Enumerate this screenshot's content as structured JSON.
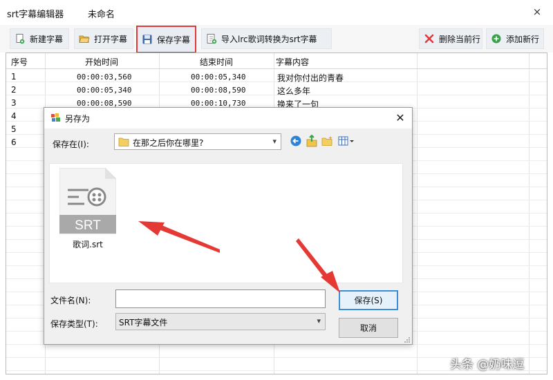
{
  "window": {
    "app_title": "srt字幕编辑器",
    "doc_title": "未命名",
    "close_glyph": "×"
  },
  "toolbar": {
    "new_label": "新建字幕",
    "open_label": "打开字幕",
    "save_label": "保存字幕",
    "import_label": "导入lrc歌词转换为srt字幕",
    "delete_label": "删除当前行",
    "add_label": "添加新行"
  },
  "table": {
    "columns": [
      "序号",
      "开始时间",
      "结束时间",
      "字幕内容"
    ],
    "rows": [
      {
        "index": "1",
        "start": "00:00:03,560",
        "end": "00:00:05,340",
        "text": "我对你付出的青春"
      },
      {
        "index": "2",
        "start": "00:00:05,340",
        "end": "00:00:08,590",
        "text": "这么多年"
      },
      {
        "index": "3",
        "start": "00:00:08,590",
        "end": "00:00:10,730",
        "text": "换来了一句"
      },
      {
        "index": "4",
        "start": "",
        "end": "",
        "text": ""
      },
      {
        "index": "5",
        "start": "",
        "end": "",
        "text": ""
      },
      {
        "index": "6",
        "start": "",
        "end": "",
        "text": ""
      }
    ]
  },
  "dialog": {
    "title": "另存为",
    "close_glyph": "✕",
    "save_in_label": "保存在(I):",
    "save_in_value": "在那之后你在哪里?",
    "file": {
      "name": "歌词.srt",
      "type_badge": "SRT"
    },
    "filename_label": "文件名(N):",
    "filename_value": "",
    "filetype_label": "保存类型(T):",
    "filetype_value": "SRT字幕文件",
    "save_button": "保存(S)",
    "cancel_button": "取消"
  },
  "watermark": "头条 @奶味逗",
  "colors": {
    "highlight_border": "#e0393a",
    "arrow": "#e53935",
    "primary_button_border": "#3c8dd9"
  },
  "icons": [
    "new-file-icon",
    "open-folder-icon",
    "floppy-disk-icon",
    "import-icon",
    "delete-x-icon",
    "add-plus-icon",
    "back-arrow-icon",
    "up-folder-icon",
    "new-folder-icon",
    "view-menu-icon",
    "srt-file-icon"
  ]
}
